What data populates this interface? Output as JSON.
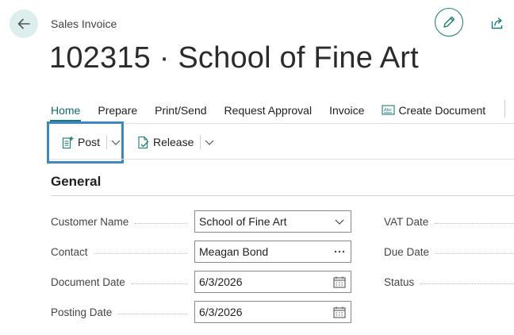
{
  "page": {
    "type_label": "Sales Invoice",
    "title": "102315 · School of Fine Art"
  },
  "header": {
    "back_icon": "arrow-left-icon",
    "edit_icon": "pencil-icon",
    "share_icon": "share-icon",
    "accent_color": "#187b78"
  },
  "tabs": [
    {
      "label": "Home",
      "active": true
    },
    {
      "label": "Prepare"
    },
    {
      "label": "Print/Send"
    },
    {
      "label": "Request Approval"
    },
    {
      "label": "Invoice"
    },
    {
      "label": "Create Document",
      "icon": "create-document-icon"
    }
  ],
  "actions": {
    "post_label": "Post",
    "release_label": "Release"
  },
  "general": {
    "section_title": "General",
    "fields": {
      "customer_name": {
        "label": "Customer Name",
        "value": "School of Fine Art"
      },
      "contact": {
        "label": "Contact",
        "value": "Meagan Bond"
      },
      "document_date": {
        "label": "Document Date",
        "value": "6/3/2026"
      },
      "posting_date": {
        "label": "Posting Date",
        "value": "6/3/2026"
      }
    },
    "right_labels": {
      "vat_date": "VAT Date",
      "due_date": "Due Date",
      "status": "Status"
    }
  },
  "highlight_color": "#3d87c4"
}
